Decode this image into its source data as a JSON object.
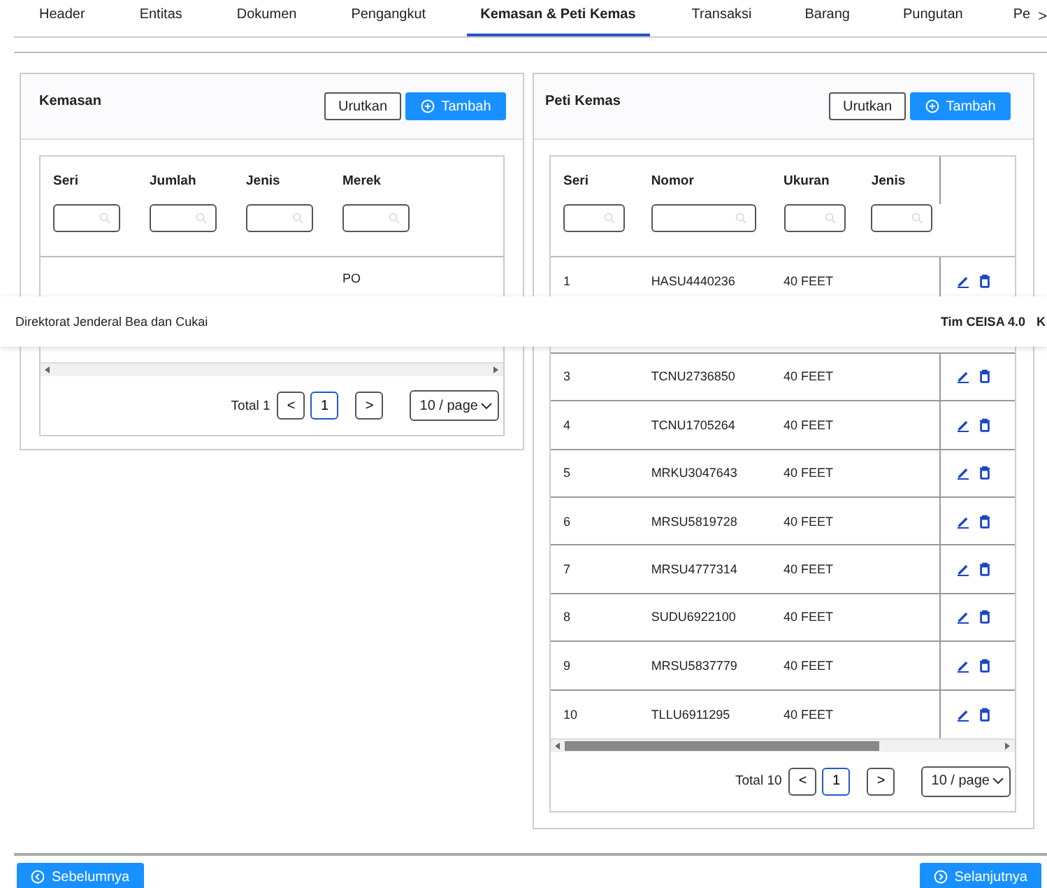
{
  "tabs": [
    {
      "label": "Header",
      "selected": false
    },
    {
      "label": "Entitas",
      "selected": false
    },
    {
      "label": "Dokumen",
      "selected": false
    },
    {
      "label": "Pengangkut",
      "selected": false
    },
    {
      "label": "Kemasan & Peti Kemas",
      "selected": true
    },
    {
      "label": "Transaksi",
      "selected": false
    },
    {
      "label": "Barang",
      "selected": false
    },
    {
      "label": "Pungutan",
      "selected": false
    },
    {
      "label": "Pe",
      "selected": false
    }
  ],
  "tab_scroll": ">",
  "kemasan": {
    "title": "Kemasan",
    "buttons": [
      {
        "label": "Urutkan",
        "kind": "outline"
      },
      {
        "label": "Tambah",
        "kind": "primary"
      }
    ],
    "table": {
      "columns": [
        "Seri",
        "Jumlah",
        "Jenis",
        "Merek"
      ],
      "rows": [
        {
          "merek": "PO"
        }
      ]
    },
    "pagination": {
      "total": "Total 1",
      "prev": "<",
      "page": "1",
      "next": ">",
      "page_size": "10 / page"
    }
  },
  "peti_kemas": {
    "title": "Peti Kemas",
    "buttons": [
      {
        "label": "Urutkan",
        "kind": "outline"
      },
      {
        "label": "Tambah",
        "kind": "primary"
      }
    ],
    "table": {
      "columns": [
        "Seri",
        "Nomor",
        "Ukuran",
        "Jenis"
      ],
      "rows": [
        {
          "seri": "1",
          "nomor": "HASU4440236",
          "ukuran": "40 FEET"
        },
        {
          "seri": "3",
          "nomor": "TCNU2736850",
          "ukuran": "40 FEET"
        },
        {
          "seri": "4",
          "nomor": "TCNU1705264",
          "ukuran": "40 FEET"
        },
        {
          "seri": "5",
          "nomor": "MRKU3047643",
          "ukuran": "40 FEET"
        },
        {
          "seri": "6",
          "nomor": "MRSU5819728",
          "ukuran": "40 FEET"
        },
        {
          "seri": "7",
          "nomor": "MRSU4777314",
          "ukuran": "40 FEET"
        },
        {
          "seri": "8",
          "nomor": "SUDU6922100",
          "ukuran": "40 FEET"
        },
        {
          "seri": "9",
          "nomor": "MRSU5837779",
          "ukuran": "40 FEET"
        },
        {
          "seri": "10",
          "nomor": "TLLU6911295",
          "ukuran": "40 FEET"
        }
      ]
    },
    "pagination": {
      "total": "Total 10",
      "prev": "<",
      "page": "1",
      "next": ">",
      "page_size": "10 / page"
    }
  },
  "banner": {
    "left": "Direktorat Jenderal Bea dan Cukai",
    "right": [
      "Tim CEISA 4.0",
      "K"
    ]
  },
  "footer": {
    "previous": "Sebelumnya",
    "next": "Selanjutnya"
  }
}
